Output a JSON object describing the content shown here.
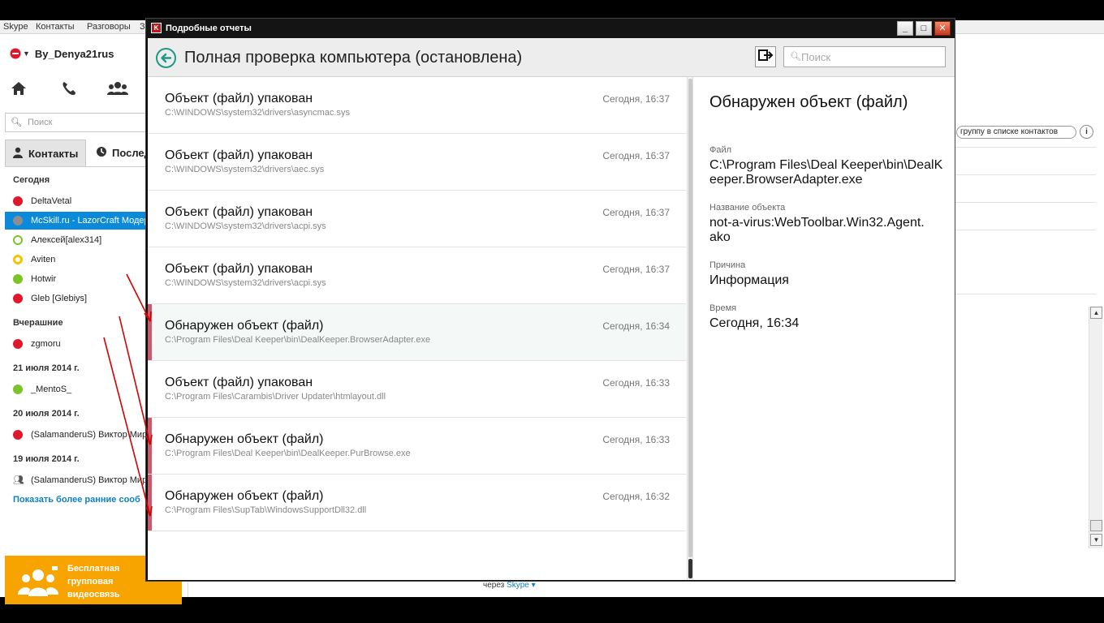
{
  "skype": {
    "menu": [
      "Skype",
      "Контакты",
      "Разговоры",
      "З"
    ],
    "username": "By_Denya21rus",
    "search_placeholder": "Поиск",
    "tabs": {
      "contacts": "Контакты",
      "recent": "Последние"
    },
    "groups": [
      {
        "header": "Сегодня",
        "items": [
          {
            "name": "DeltaVetal",
            "status": "red"
          },
          {
            "name": "McSkill.ru - LazorCraft Модер",
            "status": "grey",
            "selected": true
          },
          {
            "name": "Алексей[alex314]",
            "status": "green-o"
          },
          {
            "name": "Aviten",
            "status": "yellow"
          },
          {
            "name": "Hotwir",
            "status": "green"
          },
          {
            "name": "Gleb [Glebiys]",
            "status": "red"
          }
        ]
      },
      {
        "header": "Вчерашние",
        "items": [
          {
            "name": "zgmoru",
            "status": "red"
          }
        ]
      },
      {
        "header": "21 июля 2014 г.",
        "items": [
          {
            "name": "_MentoS_",
            "status": "green"
          }
        ]
      },
      {
        "header": "20 июля 2014 г.",
        "items": [
          {
            "name": "(SalamanderuS) Виктор Мирн",
            "status": "red"
          }
        ]
      },
      {
        "header": "19 июля 2014 г.",
        "items": [
          {
            "name": "(SalamanderuS) Виктор Мирн",
            "status": "group"
          }
        ]
      }
    ],
    "show_more": "Показать более ранние сооб",
    "promo": "Бесплатная групповая видеосвязь",
    "add_group_button": "группу в списке контактов",
    "via_label": "через",
    "via_link": "Skype"
  },
  "report": {
    "window_title": "Подробные отчеты",
    "heading": "Полная проверка компьютера (остановлена)",
    "search_placeholder": "Поиск",
    "rows": [
      {
        "title": "Объект (файл) упакован",
        "path": "C:\\WINDOWS\\system32\\drivers\\asyncmac.sys",
        "time": "Сегодня, 16:37",
        "detected": false
      },
      {
        "title": "Объект (файл) упакован",
        "path": "C:\\WINDOWS\\system32\\drivers\\aec.sys",
        "time": "Сегодня, 16:37",
        "detected": false
      },
      {
        "title": "Объект (файл) упакован",
        "path": "C:\\WINDOWS\\system32\\drivers\\acpi.sys",
        "time": "Сегодня, 16:37",
        "detected": false
      },
      {
        "title": "Объект (файл) упакован",
        "path": "C:\\WINDOWS\\system32\\drivers\\acpi.sys",
        "time": "Сегодня, 16:37",
        "detected": false
      },
      {
        "title": "Обнаружен объект (файл)",
        "path": "C:\\Program Files\\Deal Keeper\\bin\\DealKeeper.BrowserAdapter.exe",
        "time": "Сегодня, 16:34",
        "detected": true,
        "selected": true
      },
      {
        "title": "Объект (файл) упакован",
        "path": "C:\\Program Files\\Carambis\\Driver Updater\\htmlayout.dll",
        "time": "Сегодня, 16:33",
        "detected": false
      },
      {
        "title": "Обнаружен объект (файл)",
        "path": "C:\\Program Files\\Deal Keeper\\bin\\DealKeeper.PurBrowse.exe",
        "time": "Сегодня, 16:33",
        "detected": true
      },
      {
        "title": "Обнаружен объект (файл)",
        "path": "C:\\Program Files\\SupTab\\WindowsSupportDll32.dll",
        "time": "Сегодня, 16:32",
        "detected": true
      }
    ],
    "detail": {
      "title": "Обнаружен объект (файл)",
      "file_label": "Файл",
      "file_value": "C:\\Program Files\\Deal Keeper\\bin\\DealKeeper.BrowserAdapter.exe",
      "name_label": "Название объекта",
      "name_value": "not-a-virus:WebToolbar.Win32.Agent.ako",
      "reason_label": "Причина",
      "reason_value": "Информация",
      "time_label": "Время",
      "time_value": "Сегодня, 16:34"
    }
  },
  "colors": {
    "skype_blue": "#0a8ad8",
    "promo_orange": "#f7a300",
    "kaspersky_green": "#1c9a83",
    "detected_marker": "#c85a6e",
    "annotation_red": "#d40000"
  }
}
